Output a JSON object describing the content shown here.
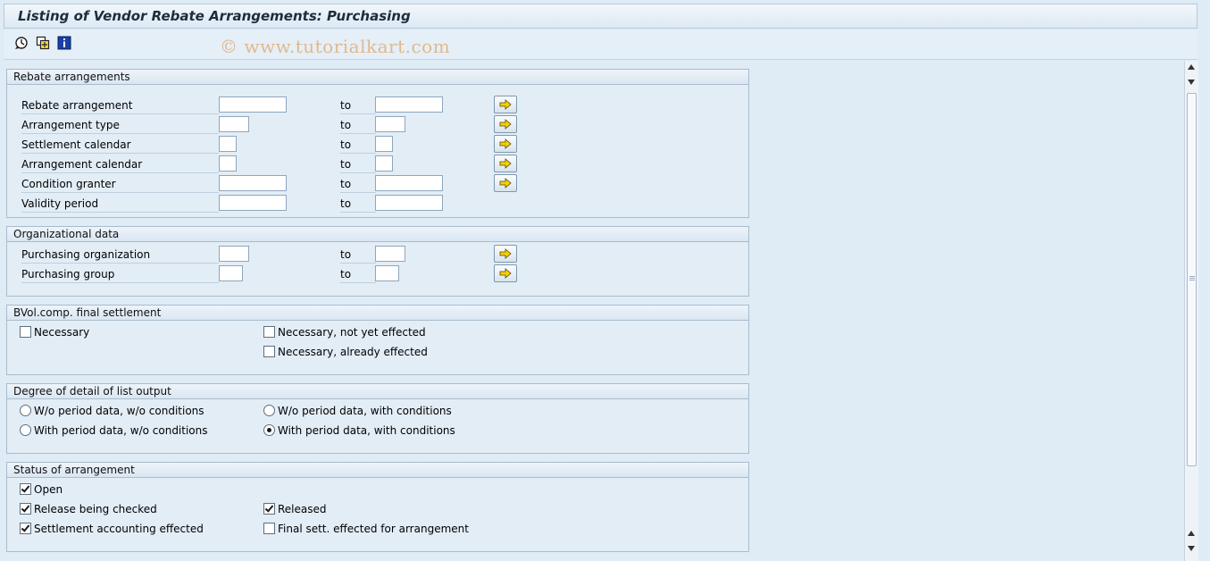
{
  "title": "Listing of Vendor Rebate Arrangements: Purchasing",
  "watermark": "© www.tutorialkart.com",
  "toolbar": {
    "icons": [
      "execute-icon",
      "get-variant-icon",
      "program-info-icon"
    ]
  },
  "to_label": "to",
  "groups": {
    "rebate": {
      "title": "Rebate arrangements",
      "rows": [
        {
          "label": "Rebate arrangement",
          "from": "",
          "to": ""
        },
        {
          "label": "Arrangement type",
          "from": "",
          "to": ""
        },
        {
          "label": "Settlement calendar",
          "from": "",
          "to": ""
        },
        {
          "label": "Arrangement calendar",
          "from": "",
          "to": ""
        },
        {
          "label": "Condition granter",
          "from": "",
          "to": ""
        },
        {
          "label": "Validity period",
          "from": "",
          "to": ""
        }
      ]
    },
    "org": {
      "title": "Organizational data",
      "rows": [
        {
          "label": "Purchasing organization",
          "from": "",
          "to": ""
        },
        {
          "label": "Purchasing group",
          "from": "",
          "to": ""
        }
      ]
    },
    "bvol": {
      "title": "BVol.comp. final settlement",
      "options": [
        {
          "label": "Necessary",
          "checked": false
        },
        {
          "label": "Necessary, not yet effected",
          "checked": false
        },
        {
          "label": "Necessary, already effected",
          "checked": false
        }
      ]
    },
    "detail": {
      "title": "Degree of detail of list output",
      "options": [
        {
          "label": "W/o period data, w/o conditions",
          "selected": false
        },
        {
          "label": "W/o period data, with conditions",
          "selected": false
        },
        {
          "label": "With period data, w/o conditions",
          "selected": false
        },
        {
          "label": "With period data, with conditions",
          "selected": true
        }
      ]
    },
    "status": {
      "title": "Status of arrangement",
      "options": [
        {
          "label": "Open",
          "checked": true
        },
        {
          "label": "Release being checked",
          "checked": true
        },
        {
          "label": "Released",
          "checked": true
        },
        {
          "label": "Settlement accounting effected",
          "checked": true
        },
        {
          "label": "Final sett. effected for arrangement",
          "checked": false
        }
      ]
    }
  },
  "colors": {
    "background": "#dfebf5",
    "group_border": "#a9bccd",
    "multi_select_arrow": "#f5d000"
  }
}
